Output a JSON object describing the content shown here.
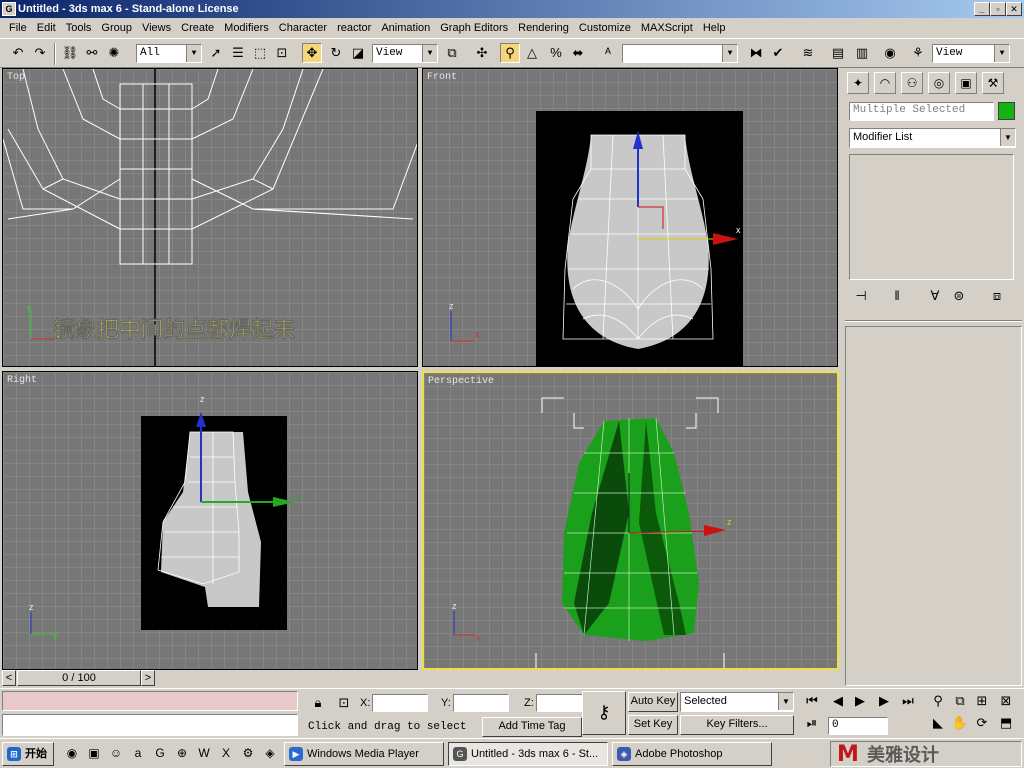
{
  "window": {
    "title": "Untitled - 3ds max 6 - Stand-alone License",
    "minimize": "_",
    "maximize": "▫",
    "close": "✕"
  },
  "menu": [
    "File",
    "Edit",
    "Tools",
    "Group",
    "Views",
    "Create",
    "Modifiers",
    "Character",
    "reactor",
    "Animation",
    "Graph Editors",
    "Rendering",
    "Customize",
    "MAXScript",
    "Help"
  ],
  "toolbar": {
    "selection_filter": "All",
    "ref_coord": "View",
    "named_selection": "",
    "render_type": "View"
  },
  "viewports": {
    "top": {
      "label": "Top",
      "annotation": "镜象把中间的点都焊起来"
    },
    "front": {
      "label": "Front"
    },
    "right": {
      "label": "Right"
    },
    "perspective": {
      "label": "Perspective"
    }
  },
  "axes": {
    "x": "x",
    "y": "y",
    "z": "z"
  },
  "command_panel": {
    "object_name": "Multiple Selected",
    "object_color": "#12b412",
    "modifier_list": "Modifier List"
  },
  "time_slider": {
    "label": "0 / 100",
    "prev": "<",
    "next": ">"
  },
  "status": {
    "x_label": "X:",
    "y_label": "Y:",
    "z_label": "Z:",
    "prompt": "Click and drag to select",
    "add_time_tag": "Add Time Tag",
    "auto_key": "Auto Key",
    "set_key": "Set Key",
    "key_mode": "Selected",
    "key_filters": "Key Filters...",
    "frame": "0"
  },
  "taskbar": {
    "start": "开始",
    "tasks": [
      "Windows Media Player",
      "Untitled - 3ds max 6 - St...",
      "Adobe Photoshop"
    ],
    "watermark": "美雅设计"
  },
  "colors": {
    "green_mesh": "#1aa01a",
    "active_border": "#f0e040",
    "annotation": "#ffff33"
  }
}
